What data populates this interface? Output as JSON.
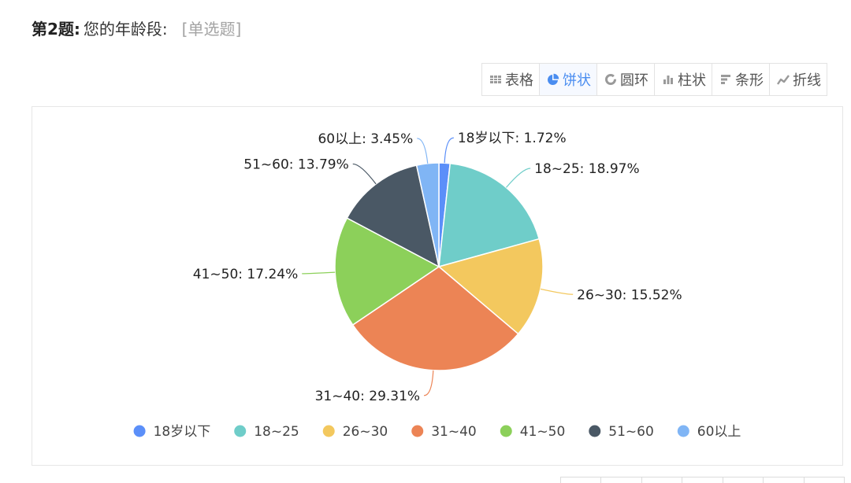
{
  "question": {
    "number": "第2题:",
    "text": "您的年龄段:",
    "type": "[单选题]"
  },
  "toolbar": {
    "buttons": [
      {
        "label": "表格",
        "icon": "table-icon",
        "active": false
      },
      {
        "label": "饼状",
        "icon": "pie-icon",
        "active": true
      },
      {
        "label": "圆环",
        "icon": "donut-icon",
        "active": false
      },
      {
        "label": "柱状",
        "icon": "bar-chart-icon",
        "active": false
      },
      {
        "label": "条形",
        "icon": "horizontal-bar-icon",
        "active": false
      },
      {
        "label": "折线",
        "icon": "line-chart-icon",
        "active": false
      }
    ]
  },
  "chart_data": {
    "type": "pie",
    "title": "",
    "slices": [
      {
        "label": "18岁以下",
        "value": 1.72,
        "color": "#5b8ff9"
      },
      {
        "label": "18~25",
        "value": 18.97,
        "color": "#6fcdc9"
      },
      {
        "label": "26~30",
        "value": 15.52,
        "color": "#f3c85e"
      },
      {
        "label": "31~40",
        "value": 29.31,
        "color": "#ec8455"
      },
      {
        "label": "41~50",
        "value": 17.24,
        "color": "#8cd05a"
      },
      {
        "label": "51~60",
        "value": 13.79,
        "color": "#4a5865"
      },
      {
        "label": "60以上",
        "value": 3.45,
        "color": "#80b5f5"
      }
    ],
    "value_suffix": "%",
    "legend_position": "bottom"
  }
}
